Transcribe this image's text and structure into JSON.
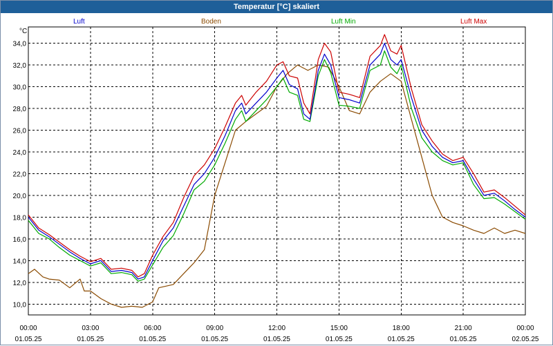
{
  "window": {
    "title": "Temperatur [°C] skaliert"
  },
  "colors": {
    "titlebar": "#1e5f99",
    "grid": "#000000"
  },
  "chart_data": {
    "type": "line",
    "title": "Temperatur [°C] skaliert",
    "ylabel": "°C",
    "ylim": [
      9.0,
      35.5
    ],
    "y_ticks": [
      "10,0",
      "12,0",
      "14,0",
      "16,0",
      "18,0",
      "20,0",
      "22,0",
      "24,0",
      "26,0",
      "28,0",
      "30,0",
      "32,0",
      "34,0"
    ],
    "y_tick_values": [
      10,
      12,
      14,
      16,
      18,
      20,
      22,
      24,
      26,
      28,
      30,
      32,
      34
    ],
    "x_range_hours": [
      0,
      24
    ],
    "x_ticks": [
      {
        "time": "00:00",
        "date": "01.05.25"
      },
      {
        "time": "03:00",
        "date": "01.05.25"
      },
      {
        "time": "06:00",
        "date": "01.05.25"
      },
      {
        "time": "09:00",
        "date": "01.05.25"
      },
      {
        "time": "12:00",
        "date": "01.05.25"
      },
      {
        "time": "15:00",
        "date": "01.05.25"
      },
      {
        "time": "18:00",
        "date": "01.05.25"
      },
      {
        "time": "21:00",
        "date": "01.05.25"
      },
      {
        "time": "00:00",
        "date": "02.05.25"
      }
    ],
    "grid": true,
    "legend_position": "top",
    "series": [
      {
        "name": "Luft",
        "color": "#0000cc",
        "points": [
          [
            0,
            18.0
          ],
          [
            0.5,
            16.8
          ],
          [
            1,
            16.2
          ],
          [
            1.5,
            15.5
          ],
          [
            2,
            14.8
          ],
          [
            2.5,
            14.2
          ],
          [
            3,
            13.7
          ],
          [
            3.5,
            14.0
          ],
          [
            4,
            13.0
          ],
          [
            4.5,
            13.1
          ],
          [
            5,
            12.9
          ],
          [
            5.3,
            12.3
          ],
          [
            5.6,
            12.5
          ],
          [
            6,
            14.0
          ],
          [
            6.5,
            15.8
          ],
          [
            7,
            17.0
          ],
          [
            7.5,
            19.0
          ],
          [
            8,
            21.0
          ],
          [
            8.5,
            22.0
          ],
          [
            9,
            23.5
          ],
          [
            9.5,
            25.5
          ],
          [
            10,
            27.8
          ],
          [
            10.3,
            28.5
          ],
          [
            10.5,
            27.5
          ],
          [
            11,
            28.5
          ],
          [
            11.5,
            29.5
          ],
          [
            12,
            30.8
          ],
          [
            12.3,
            31.5
          ],
          [
            12.6,
            30.2
          ],
          [
            13,
            29.8
          ],
          [
            13.3,
            27.5
          ],
          [
            13.6,
            27.0
          ],
          [
            14,
            31.5
          ],
          [
            14.3,
            33.0
          ],
          [
            14.6,
            32.0
          ],
          [
            15,
            29.0
          ],
          [
            15.5,
            28.8
          ],
          [
            16,
            28.5
          ],
          [
            16.5,
            32.0
          ],
          [
            17,
            33.0
          ],
          [
            17.2,
            34.0
          ],
          [
            17.5,
            32.5
          ],
          [
            17.8,
            32.0
          ],
          [
            18,
            32.5
          ],
          [
            18.5,
            29.0
          ],
          [
            19,
            26.0
          ],
          [
            19.5,
            24.5
          ],
          [
            20,
            23.5
          ],
          [
            20.5,
            23.0
          ],
          [
            21,
            23.2
          ],
          [
            21.5,
            21.5
          ],
          [
            22,
            20.0
          ],
          [
            22.5,
            20.2
          ],
          [
            23,
            19.5
          ],
          [
            23.5,
            18.7
          ],
          [
            24,
            18.0
          ]
        ]
      },
      {
        "name": "Boden",
        "color": "#8a4a00",
        "points": [
          [
            0,
            12.8
          ],
          [
            0.3,
            13.2
          ],
          [
            0.7,
            12.5
          ],
          [
            1,
            12.3
          ],
          [
            1.5,
            12.2
          ],
          [
            2,
            11.5
          ],
          [
            2.5,
            12.3
          ],
          [
            2.7,
            11.2
          ],
          [
            3,
            11.2
          ],
          [
            3.5,
            10.5
          ],
          [
            4,
            10.0
          ],
          [
            4.5,
            9.7
          ],
          [
            5,
            9.8
          ],
          [
            5.5,
            9.7
          ],
          [
            6,
            10.2
          ],
          [
            6.3,
            11.5
          ],
          [
            7,
            11.8
          ],
          [
            7.5,
            12.8
          ],
          [
            8,
            13.8
          ],
          [
            8.5,
            15.0
          ],
          [
            9,
            20.0
          ],
          [
            9.5,
            23.0
          ],
          [
            10,
            26.0
          ],
          [
            10.5,
            26.8
          ],
          [
            11,
            27.5
          ],
          [
            11.5,
            28.2
          ],
          [
            12,
            30.0
          ],
          [
            12.5,
            31.2
          ],
          [
            13,
            32.0
          ],
          [
            13.5,
            31.5
          ],
          [
            14,
            32.0
          ],
          [
            14.5,
            31.8
          ],
          [
            15,
            30.0
          ],
          [
            15.5,
            27.8
          ],
          [
            16,
            27.5
          ],
          [
            16.5,
            29.5
          ],
          [
            17,
            30.5
          ],
          [
            17.5,
            31.2
          ],
          [
            18,
            30.5
          ],
          [
            18.5,
            27.0
          ],
          [
            19,
            23.5
          ],
          [
            19.5,
            20.0
          ],
          [
            20,
            18.0
          ],
          [
            20.5,
            17.5
          ],
          [
            21,
            17.2
          ],
          [
            21.5,
            16.8
          ],
          [
            22,
            16.5
          ],
          [
            22.5,
            17.0
          ],
          [
            23,
            16.5
          ],
          [
            23.5,
            16.8
          ],
          [
            24,
            16.5
          ]
        ]
      },
      {
        "name": "Luft Min",
        "color": "#00aa00",
        "points": [
          [
            0,
            17.7
          ],
          [
            0.5,
            16.5
          ],
          [
            1,
            16.0
          ],
          [
            1.5,
            15.2
          ],
          [
            2,
            14.5
          ],
          [
            2.5,
            14.0
          ],
          [
            3,
            13.5
          ],
          [
            3.5,
            13.8
          ],
          [
            4,
            12.8
          ],
          [
            4.5,
            12.9
          ],
          [
            5,
            12.7
          ],
          [
            5.3,
            12.1
          ],
          [
            5.6,
            12.3
          ],
          [
            6,
            13.6
          ],
          [
            6.5,
            15.2
          ],
          [
            7,
            16.3
          ],
          [
            7.5,
            18.3
          ],
          [
            8,
            20.5
          ],
          [
            8.5,
            21.3
          ],
          [
            9,
            22.8
          ],
          [
            9.5,
            24.8
          ],
          [
            10,
            27.0
          ],
          [
            10.3,
            27.8
          ],
          [
            10.5,
            26.8
          ],
          [
            11,
            27.8
          ],
          [
            11.5,
            28.8
          ],
          [
            12,
            30.0
          ],
          [
            12.3,
            30.8
          ],
          [
            12.6,
            29.5
          ],
          [
            13,
            29.2
          ],
          [
            13.3,
            27.0
          ],
          [
            13.6,
            26.8
          ],
          [
            14,
            31.0
          ],
          [
            14.3,
            32.5
          ],
          [
            14.6,
            31.3
          ],
          [
            15,
            28.3
          ],
          [
            15.5,
            28.2
          ],
          [
            16,
            28.0
          ],
          [
            16.5,
            31.5
          ],
          [
            17,
            32.0
          ],
          [
            17.2,
            33.3
          ],
          [
            17.5,
            31.8
          ],
          [
            17.8,
            31.2
          ],
          [
            18,
            32.0
          ],
          [
            18.5,
            28.0
          ],
          [
            19,
            25.3
          ],
          [
            19.5,
            24.0
          ],
          [
            20,
            23.2
          ],
          [
            20.5,
            22.8
          ],
          [
            21,
            23.0
          ],
          [
            21.5,
            21.0
          ],
          [
            22,
            19.7
          ],
          [
            22.5,
            19.8
          ],
          [
            23,
            19.2
          ],
          [
            23.5,
            18.5
          ],
          [
            24,
            17.8
          ]
        ]
      },
      {
        "name": "Luft Max",
        "color": "#cc0000",
        "points": [
          [
            0,
            18.2
          ],
          [
            0.5,
            17.0
          ],
          [
            1,
            16.4
          ],
          [
            1.5,
            15.7
          ],
          [
            2,
            15.0
          ],
          [
            2.5,
            14.4
          ],
          [
            3,
            13.9
          ],
          [
            3.5,
            14.2
          ],
          [
            4,
            13.2
          ],
          [
            4.5,
            13.3
          ],
          [
            5,
            13.1
          ],
          [
            5.3,
            12.5
          ],
          [
            5.6,
            12.8
          ],
          [
            6,
            14.5
          ],
          [
            6.5,
            16.2
          ],
          [
            7,
            17.5
          ],
          [
            7.5,
            19.8
          ],
          [
            8,
            21.8
          ],
          [
            8.5,
            22.8
          ],
          [
            9,
            24.3
          ],
          [
            9.5,
            26.3
          ],
          [
            10,
            28.5
          ],
          [
            10.3,
            29.2
          ],
          [
            10.5,
            28.3
          ],
          [
            11,
            29.5
          ],
          [
            11.5,
            30.5
          ],
          [
            12,
            32.0
          ],
          [
            12.3,
            32.3
          ],
          [
            12.6,
            31.0
          ],
          [
            13,
            30.8
          ],
          [
            13.3,
            28.5
          ],
          [
            13.6,
            27.5
          ],
          [
            14,
            32.5
          ],
          [
            14.3,
            34.0
          ],
          [
            14.6,
            33.2
          ],
          [
            15,
            29.5
          ],
          [
            15.5,
            29.3
          ],
          [
            16,
            29.0
          ],
          [
            16.5,
            32.8
          ],
          [
            17,
            33.8
          ],
          [
            17.2,
            34.8
          ],
          [
            17.5,
            33.3
          ],
          [
            17.8,
            33.0
          ],
          [
            18,
            33.8
          ],
          [
            18.5,
            29.8
          ],
          [
            19,
            26.5
          ],
          [
            19.5,
            25.0
          ],
          [
            20,
            23.8
          ],
          [
            20.5,
            23.2
          ],
          [
            21,
            23.5
          ],
          [
            21.5,
            22.0
          ],
          [
            22,
            20.3
          ],
          [
            22.5,
            20.5
          ],
          [
            23,
            19.8
          ],
          [
            23.5,
            19.0
          ],
          [
            24,
            18.2
          ]
        ]
      }
    ]
  }
}
